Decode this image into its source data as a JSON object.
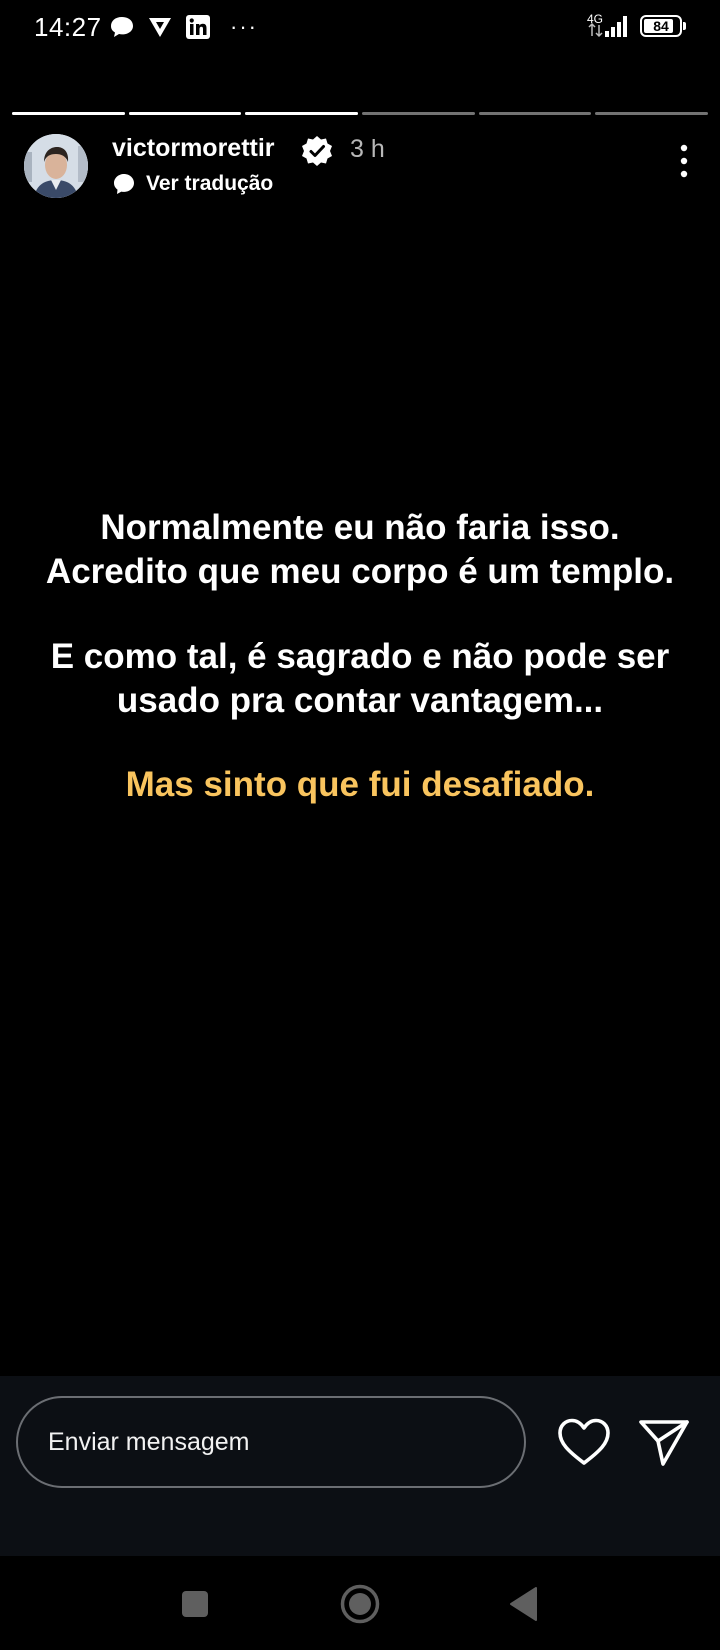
{
  "status_bar": {
    "time": "14:27",
    "more": "···",
    "network": "4G",
    "battery": "84",
    "battery_level": 0.84,
    "icons": [
      "chat-bubble-icon",
      "vpn-triangle-icon",
      "linkedin-icon",
      "more-dots-icon",
      "signal-icon",
      "battery-icon"
    ]
  },
  "story": {
    "progress_total": 6,
    "progress_completed": 3,
    "username": "victormorettir",
    "verified": true,
    "time_ago": "3 h",
    "translate_label": "Ver tradução",
    "lines": [
      "Normalmente eu não faria isso.",
      "Acredito que meu corpo é um templo.",
      "E como tal, é sagrado e não pode ser",
      "usado pra contar vantagem...",
      "Mas sinto que fui desafiado."
    ],
    "highlight_color": "#f9c45e"
  },
  "reply": {
    "placeholder": "Enviar mensagem",
    "icons": [
      "heart-icon",
      "send-icon"
    ]
  },
  "navigation": {
    "icons": [
      "recents-square-icon",
      "home-circle-icon",
      "back-triangle-icon"
    ]
  }
}
